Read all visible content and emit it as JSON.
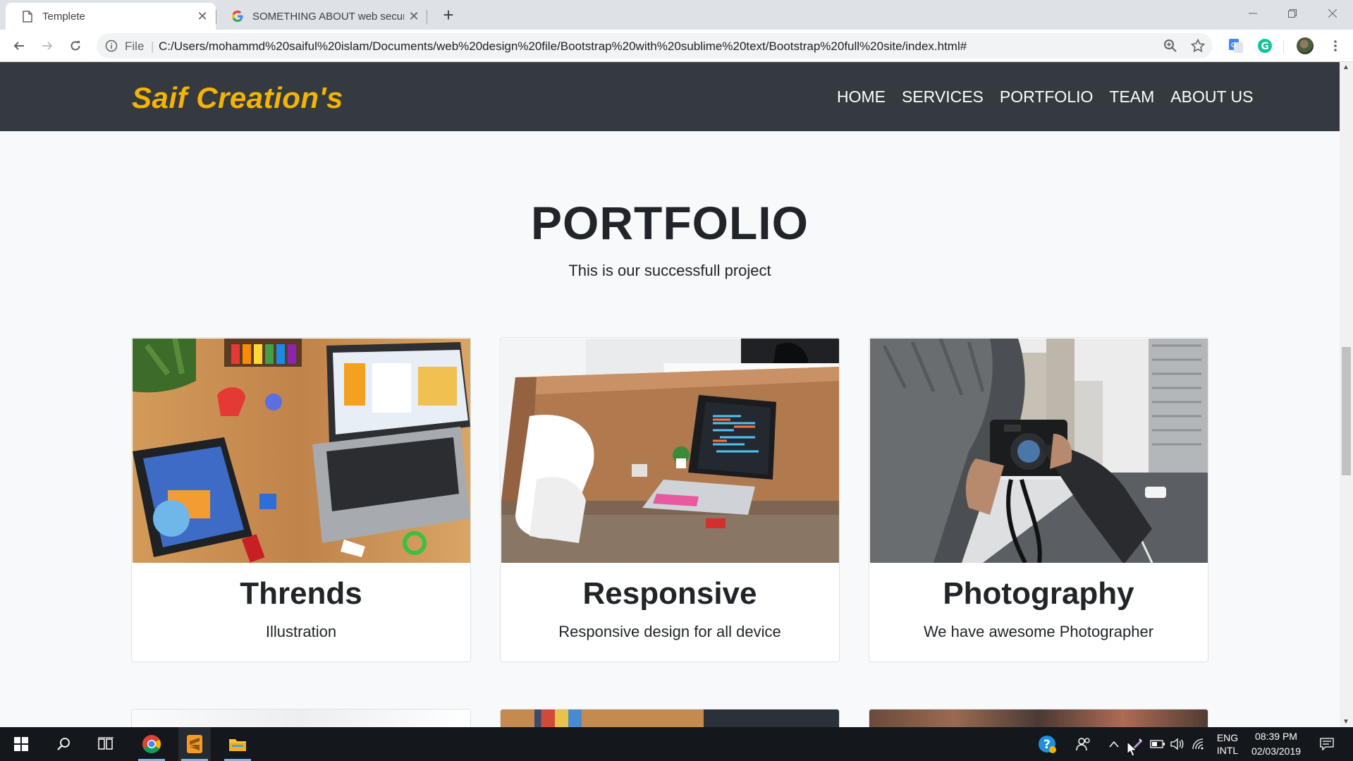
{
  "browser": {
    "tabs": [
      {
        "title": "Templete",
        "icon": "page-icon",
        "active": true
      },
      {
        "title": "SOMETHING ABOUT web securit",
        "icon": "google-icon",
        "active": false
      }
    ],
    "address": {
      "scheme_label": "File",
      "separator": "|",
      "url": "C:/Users/mohammd%20saiful%20islam/Documents/web%20design%20file/Bootstrap%20with%20sublime%20text/Bootstrap%20full%20site/index.html#"
    }
  },
  "site": {
    "brand": "Saif Creation's",
    "brand_color": "#f5b400",
    "nav_bg": "#343a40",
    "nav": [
      "HOME",
      "SERVICES",
      "PORTFOLIO",
      "TEAM",
      "ABOUT US"
    ]
  },
  "portfolio": {
    "title": "PORTFOLIO",
    "subtitle": "This is our successfull project",
    "cards": [
      {
        "title": "Thrends",
        "text": "Illustration",
        "image": "kids-coding-laptop-desk-photo"
      },
      {
        "title": "Responsive",
        "text": "Responsive design for all device",
        "image": "laptop-on-wooden-desk-photo"
      },
      {
        "title": "Photography",
        "text": "We have awesome Photographer",
        "image": "photographer-with-camera-street-photo"
      }
    ]
  },
  "taskbar": {
    "language": [
      "ENG",
      "INTL"
    ],
    "time": "08:39 PM",
    "date": "02/03/2019",
    "apps": [
      "chrome-icon",
      "sublime-text-icon",
      "file-explorer-icon"
    ]
  }
}
